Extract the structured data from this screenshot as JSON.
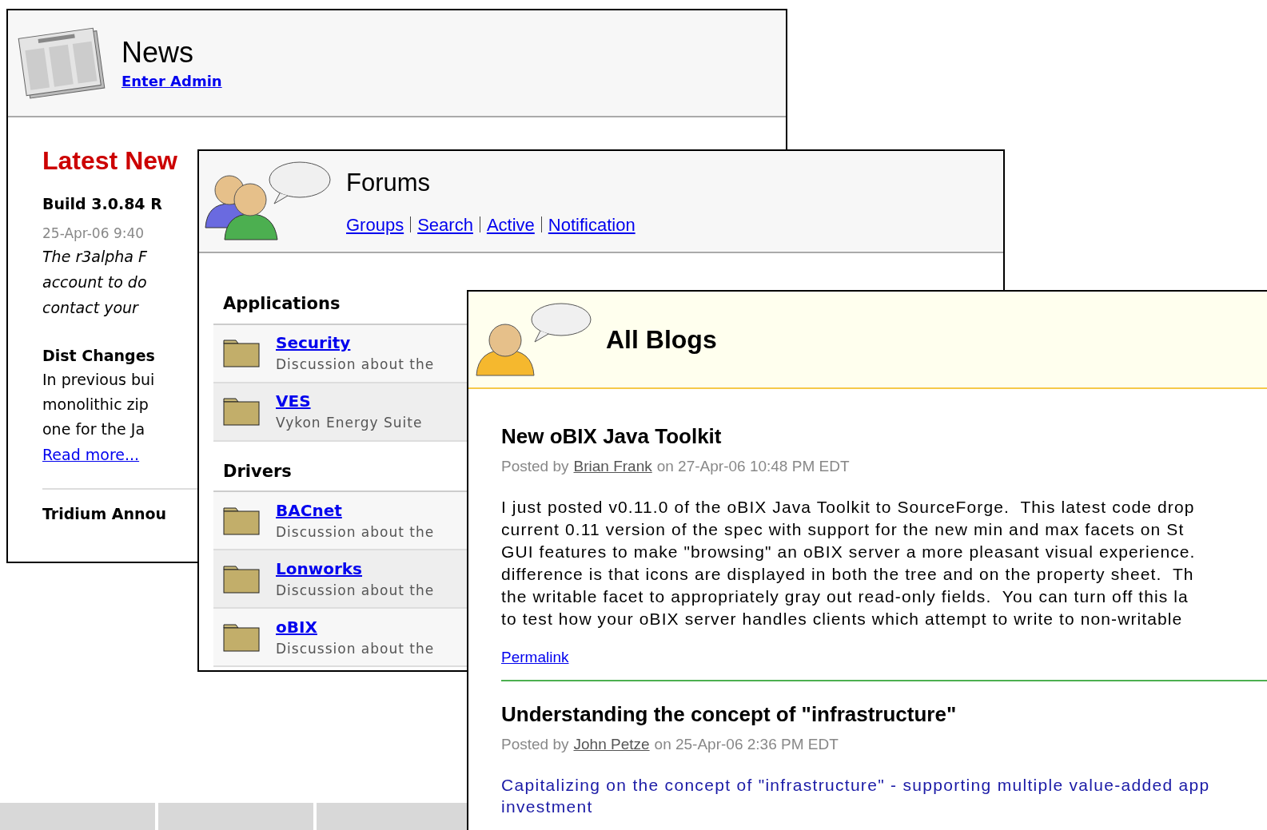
{
  "news": {
    "title": "News",
    "admin_link": "Enter Admin",
    "heading": "Latest New",
    "items": [
      {
        "kind": "post",
        "title": "Build 3.0.84 R",
        "date": "25-Apr-06 9:40",
        "lines": [
          "The r3alpha F",
          "account to do",
          "contact your"
        ]
      },
      {
        "kind": "change",
        "title": "Dist Changes",
        "lines": [
          "In previous bui",
          "monolithic zip",
          "one for the Ja"
        ],
        "link": "Read more..."
      },
      {
        "kind": "post",
        "title": "Tridium Annou"
      }
    ]
  },
  "forums": {
    "title": "Forums",
    "links": [
      "Groups",
      "Search",
      "Active",
      "Notification"
    ],
    "groups": [
      {
        "name": "Applications",
        "forums": [
          {
            "name": "Security",
            "description": "Discussion about the"
          },
          {
            "name": "VES",
            "description": "Vykon Energy Suite"
          }
        ]
      },
      {
        "name": "Drivers",
        "forums": [
          {
            "name": "BACnet",
            "description": "Discussion about the"
          },
          {
            "name": "Lonworks",
            "description": "Discussion about the"
          },
          {
            "name": "oBIX",
            "description": "Discussion about the"
          }
        ]
      }
    ]
  },
  "blogs": {
    "title": "All Blogs",
    "entries": [
      {
        "title": "New oBIX Java Toolkit",
        "posted_by": "Posted by",
        "author": "Brian Frank",
        "when": "on 27-Apr-06 10:48 PM EDT",
        "kind": "plain",
        "lines": [
          "I just posted v0.11.0 of the oBIX Java Toolkit to SourceForge.  This latest code drop",
          "current 0.11 version of the spec with support for the new min and max facets on St",
          "GUI features to make \"browsing\" an oBIX server a more pleasant visual experience.",
          "difference is that icons are displayed in both the tree and on the property sheet.  Th",
          "the writable facet to appropriately gray out read-only fields.  You can turn off this la",
          "to test how your oBIX server handles clients which attempt to write to non-writable"
        ],
        "link": "Permalink"
      },
      {
        "title": "Understanding the concept of \"infrastructure\"",
        "posted_by": "Posted by",
        "author": "John Petze",
        "when": "on 25-Apr-06 2:36 PM EDT",
        "kind": "summary",
        "lines": [
          "Capitalizing on the concept of \"infrastructure\" - supporting multiple value-added app",
          "investment"
        ]
      }
    ]
  }
}
